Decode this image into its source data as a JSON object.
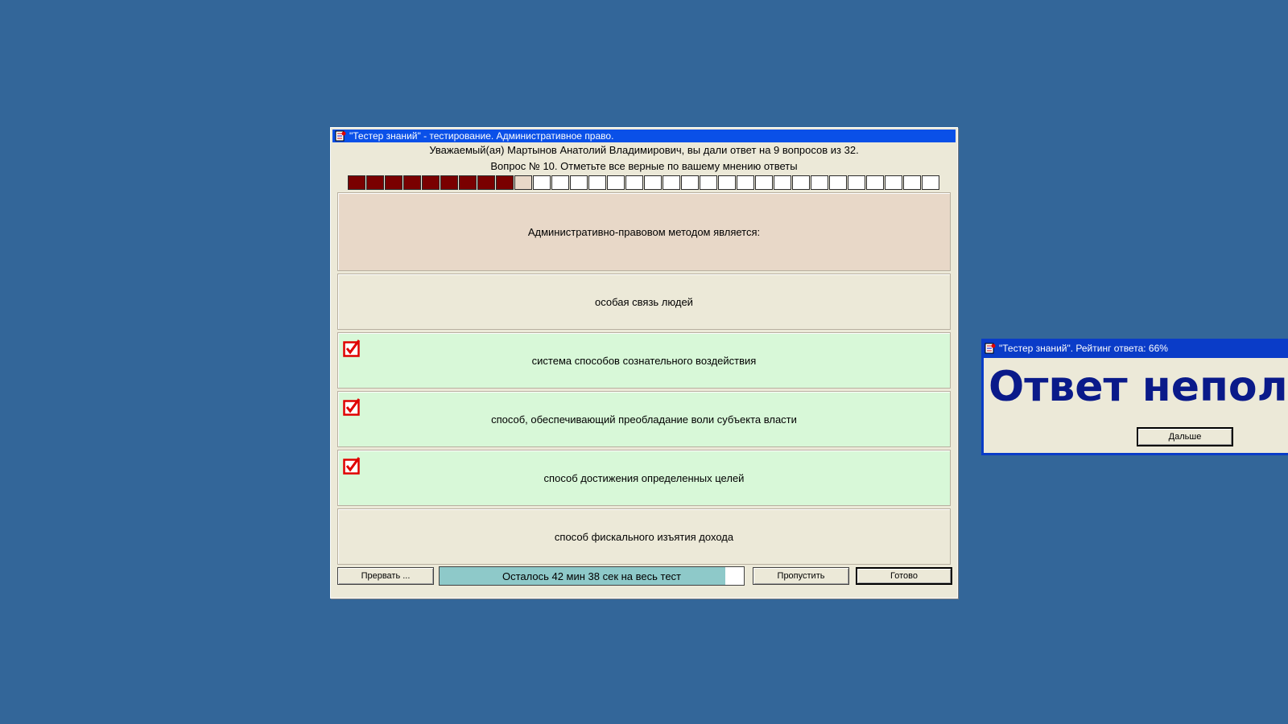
{
  "main_window": {
    "title": "\"Тестер знаний\" - тестирование. Административное право.",
    "greeting": "Уважаемый(ая) Мартынов Анатолий Владимирович, вы дали ответ на 9 вопросов из 32.",
    "question_line": "Вопрос № 10. Отметьте все верные по вашему мнению ответы",
    "progress": {
      "total": 32,
      "answered": 9,
      "current": 10
    },
    "question_text": "Административно-правовом методом является:",
    "answers": [
      {
        "text": "особая связь людей",
        "checked": false
      },
      {
        "text": "система способов сознательного воздействия",
        "checked": true
      },
      {
        "text": "способ, обеспечивающий преобладание воли субъекта власти",
        "checked": true
      },
      {
        "text": "способ достижения определенных целей",
        "checked": true
      },
      {
        "text": "способ фискального изъятия дохода",
        "checked": false
      }
    ],
    "buttons": {
      "abort": "Прервать ...",
      "skip": "Пропустить",
      "done": "Готово"
    },
    "timer": {
      "text": "Осталось 42 мин 38 сек на весь тест",
      "fraction_remaining": 0.94
    }
  },
  "popup": {
    "title": "\"Тестер знаний\". Рейтинг ответа: 66%",
    "message": "Ответ неполн",
    "next_button": "Дальше"
  },
  "colors": {
    "desktop": "#336699",
    "titlebar": "#0a50e8",
    "answered_cell": "#7a0000",
    "selected_answer": "#d8f8d8",
    "question_bg": "#e8d8c8",
    "check_red": "#e00000",
    "popup_text": "#0a1a8a"
  },
  "icons": {
    "app_icon": "test-sheet-icon",
    "checkbox": "checkmark-icon"
  }
}
